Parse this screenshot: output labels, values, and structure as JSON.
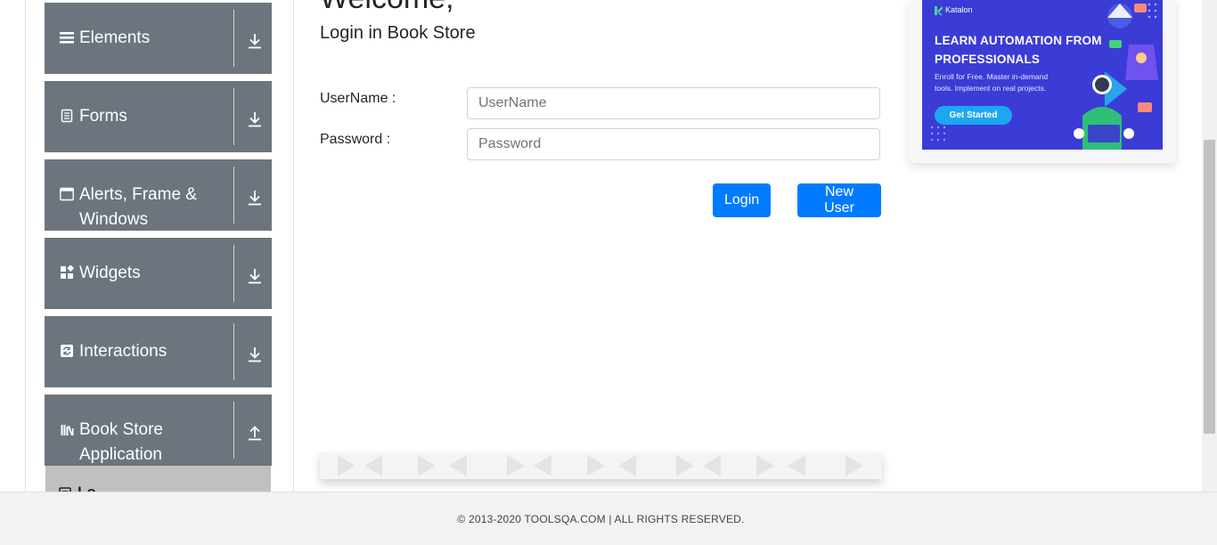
{
  "sidebar": {
    "groups": [
      {
        "label": "Elements",
        "icon": "hamburger-icon"
      },
      {
        "label": "Forms",
        "icon": "document-icon"
      },
      {
        "label": "Alerts, Frame & Windows",
        "icon": "window-icon"
      },
      {
        "label": "Widgets",
        "icon": "widgets-icon"
      },
      {
        "label": "Interactions",
        "icon": "refresh-icon"
      },
      {
        "label": "Book Store Application",
        "icon": "books-icon"
      }
    ],
    "partial_item_label": "Lo"
  },
  "main": {
    "title": "Welcome,",
    "subtitle": "Login in Book Store",
    "username_label": "UserName :",
    "username_placeholder": "UserName",
    "username_value": "",
    "password_label": "Password :",
    "password_placeholder": "Password",
    "password_value": "",
    "login_button": "Login",
    "new_user_button": "New User"
  },
  "ad": {
    "brand": "Katalon",
    "headline": "LEARN AUTOMATION FROM PROFESSIONALS",
    "subtext": "Enroll for Free. Master in-demand tools. Implement on real projects.",
    "cta": "Get Started"
  },
  "footer": {
    "text": "© 2013-2020 TOOLSQA.COM | ALL RIGHTS RESERVED."
  },
  "colors": {
    "sidebar_group": "#6c757d",
    "button": "#007bff",
    "ad_background": "#3b3bd6",
    "footer_background": "#f2f2f2"
  }
}
